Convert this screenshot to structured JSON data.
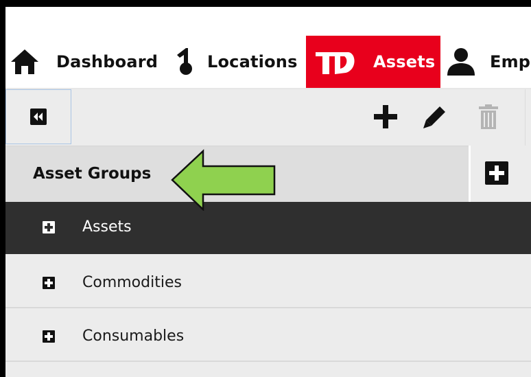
{
  "nav": {
    "items": [
      {
        "label": "Dashboard",
        "icon": "home-icon",
        "active": false
      },
      {
        "label": "Locations",
        "icon": "location-pin-icon",
        "active": false
      },
      {
        "label": "Assets",
        "icon": "assets-icon",
        "active": true
      },
      {
        "label": "Emp",
        "icon": "employee-icon",
        "active": false
      }
    ],
    "active_color": "#e8001c"
  },
  "toolbar": {
    "collapse_icon": "double-chevron-left-icon",
    "add_icon": "plus-icon",
    "edit_icon": "pencil-icon",
    "delete_icon": "trash-icon"
  },
  "section": {
    "title": "Asset Groups",
    "add_icon": "plus-square-icon"
  },
  "groups": [
    {
      "label": "Assets",
      "selected": true
    },
    {
      "label": "Commodities",
      "selected": false
    },
    {
      "label": "Consumables",
      "selected": false
    }
  ],
  "annotation": {
    "arrow_color": "#8fd14f"
  }
}
